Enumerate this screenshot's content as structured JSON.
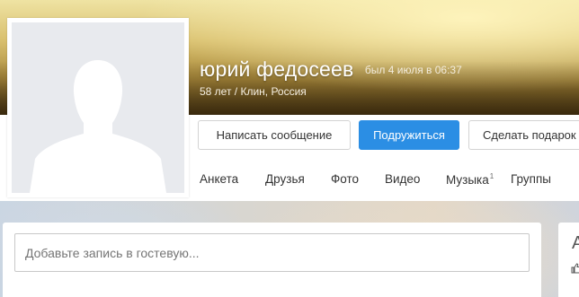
{
  "profile": {
    "name": "юрий федосеев",
    "last_seen": "был 4 июля в 06:37",
    "meta": "58 лет / Клин, Россия"
  },
  "actions": {
    "message": "Написать сообщение",
    "add_friend": "Подружиться",
    "gift": "Сделать подарок"
  },
  "tabs": [
    {
      "label": "Анкета"
    },
    {
      "label": "Друзья"
    },
    {
      "label": "Фото"
    },
    {
      "label": "Видео"
    },
    {
      "label": "Музыка",
      "count": "1"
    },
    {
      "label": "Группы"
    }
  ],
  "guestbook": {
    "placeholder": "Добавьте запись в гостевую..."
  },
  "side_card": {
    "title_initial": "А",
    "icon": "thumbs-up-icon"
  },
  "colors": {
    "accent": "#2b8ee4",
    "avatar_bg": "#e8eaee",
    "silhouette": "#ffffff"
  }
}
